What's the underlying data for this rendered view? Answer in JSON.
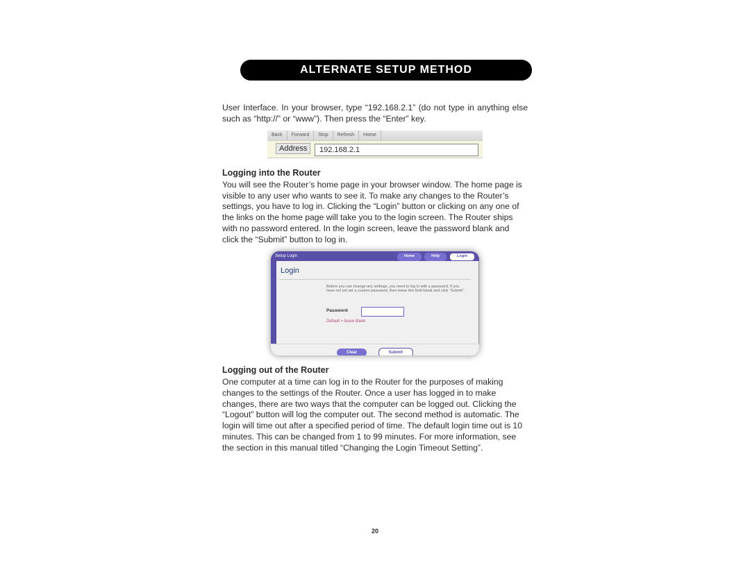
{
  "header": "ALTERNATE SETUP METHOD",
  "intro": "User Interface. In your browser, type “192.168.2.1” (do not type in anything else such as “http://” or “www”). Then press the “Enter” key.",
  "address_bar": {
    "toolbar_items": [
      "Back",
      "Forward",
      "Stop",
      "Refresh",
      "Home"
    ],
    "label": "Address",
    "value": "192.168.2.1"
  },
  "section1": {
    "title": "Logging into the Router",
    "body": "You will see the Router’s home page in your browser window. The home page is visible to any user who wants to see it. To make any changes to the Router’s settings, you have to log in. Clicking the “Login” button or clicking on any one of the links on the home page will take you to the login screen. The Router ships with no password entered. In the login screen, leave the password blank and click the “Submit” button to log in."
  },
  "login": {
    "topbar": "Setup Login",
    "nav": {
      "home": "Home",
      "help": "Help",
      "login": "Login"
    },
    "title": "Login",
    "message": "Before you can change any settings, you need to log in with a password. If you have not yet set a custom password, then leave this field blank and click “Submit”.",
    "password_label": "Password",
    "default_hint": "Default = leave blank",
    "footer": {
      "clear": "Clear",
      "submit": "Submit"
    }
  },
  "section2": {
    "title": "Logging out of the Router",
    "body": "One computer at a time can log in to the Router for the purposes of making changes to the settings of the Router. Once a user has logged in to make changes, there are two ways that the computer can be logged out. Clicking the “Logout” button will log the computer out. The second method is automatic. The login will time out after a specified period of time. The default login time out is 10 minutes. This can be changed from 1 to 99 minutes. For more information, see the section in this manual titled “Changing the Login Timeout Setting”."
  },
  "page_number": "20"
}
